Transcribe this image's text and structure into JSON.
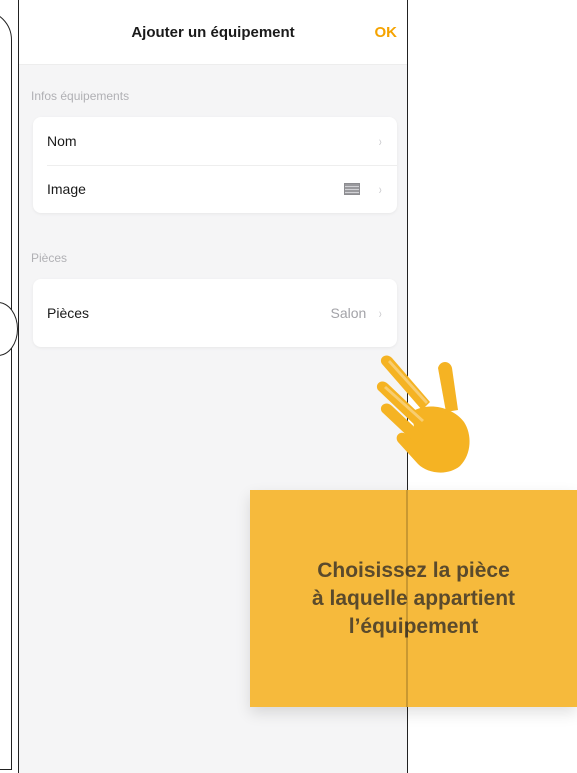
{
  "nav": {
    "title": "Ajouter un équipement",
    "ok_label": "OK"
  },
  "sections": [
    {
      "label": "Infos équipements",
      "rows": [
        {
          "label": "Nom",
          "value": ""
        },
        {
          "label": "Image",
          "value": "",
          "icon": "image-thumbnail-icon"
        }
      ]
    },
    {
      "label": "Pièces",
      "rows": [
        {
          "label": "Pièces",
          "value": "Salon"
        }
      ]
    }
  ],
  "chevron": "›",
  "callout": {
    "text": "Choisissez la pièce\nà laquelle appartient\nl’équipement"
  },
  "colors": {
    "accent": "#f5a300",
    "callout_bg": "#f6ba3c",
    "hand": "#f5b323",
    "screen_bg": "#f5f5f6"
  }
}
